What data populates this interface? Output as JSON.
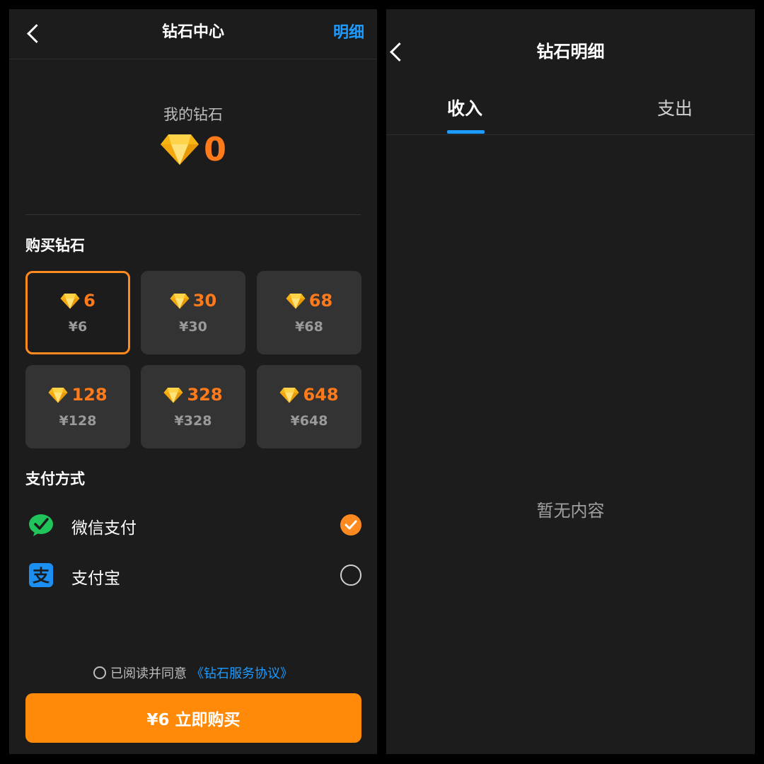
{
  "left": {
    "title": "钻石中心",
    "detail_link": "明细",
    "balance_label": "我的钻石",
    "balance_value": "0",
    "buy_section_title": "购买钻石",
    "packages": [
      {
        "amount": "6",
        "price": "¥6",
        "selected": true
      },
      {
        "amount": "30",
        "price": "¥30",
        "selected": false
      },
      {
        "amount": "68",
        "price": "¥68",
        "selected": false
      },
      {
        "amount": "128",
        "price": "¥128",
        "selected": false
      },
      {
        "amount": "328",
        "price": "¥328",
        "selected": false
      },
      {
        "amount": "648",
        "price": "¥648",
        "selected": false
      }
    ],
    "pay_section_title": "支付方式",
    "payment_methods": [
      {
        "name": "微信支付",
        "icon": "wechat-pay-icon",
        "selected": true
      },
      {
        "name": "支付宝",
        "icon": "alipay-icon",
        "selected": false
      }
    ],
    "agreement_text": "已阅读并同意",
    "agreement_link": "《钻石服务协议》",
    "buy_button": "¥6 立即购买"
  },
  "right": {
    "title": "钻石明细",
    "tabs": [
      {
        "label": "收入",
        "active": true
      },
      {
        "label": "支出",
        "active": false
      }
    ],
    "empty_text": "暂无内容"
  },
  "colors": {
    "accent_orange": "#ff8a0a",
    "diamond_number": "#ff7a1a",
    "link_blue": "#1e9bff",
    "panel_bg": "#1c1c1c",
    "card_bg": "#333333"
  }
}
